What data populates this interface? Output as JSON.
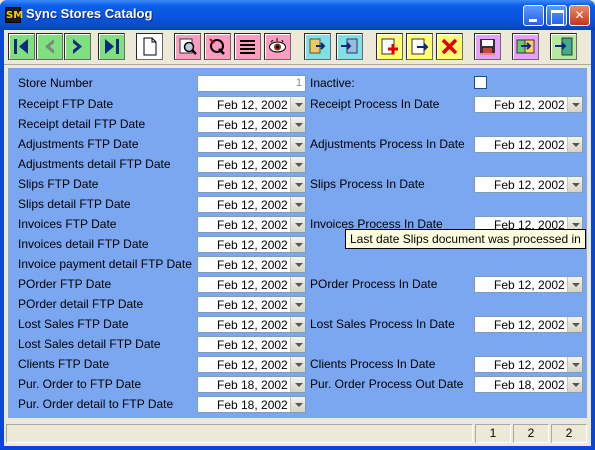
{
  "window": {
    "title": "Sync Stores Catalog",
    "icon_text": "SM"
  },
  "titlebar_buttons": [
    {
      "name": "minimize-button",
      "icon": "minimize-icon"
    },
    {
      "name": "maximize-button",
      "icon": "maximize-icon"
    },
    {
      "name": "close-button",
      "icon": "close-icon"
    }
  ],
  "toolbar": {
    "buttons": [
      {
        "name": "first-record-button",
        "icon": "first-record-icon",
        "bg": "#80e080"
      },
      {
        "name": "previous-record-button",
        "icon": "previous-record-icon",
        "bg": "#80e080"
      },
      {
        "name": "next-record-button",
        "icon": "next-record-icon",
        "bg": "#80e080"
      },
      {
        "name": "last-record-button",
        "icon": "last-record-icon",
        "bg": "#80e080"
      },
      {
        "name": "new-record-button",
        "icon": "new-document-icon",
        "bg": "#ffffff"
      },
      {
        "name": "find-button",
        "icon": "magnifier-icon",
        "bg": "#ff9cc0"
      },
      {
        "name": "query-button",
        "icon": "query-icon",
        "bg": "#ff9cc0"
      },
      {
        "name": "list-view-button",
        "icon": "list-icon",
        "bg": "#ff9cc0"
      },
      {
        "name": "preview-button",
        "icon": "eye-icon",
        "bg": "#ff9cc0"
      },
      {
        "name": "export-button",
        "icon": "export-icon",
        "bg": "#80e0e8"
      },
      {
        "name": "import-button",
        "icon": "import-icon",
        "bg": "#80e0e8"
      },
      {
        "name": "add-button",
        "icon": "add-icon",
        "bg": "#ffff70"
      },
      {
        "name": "edit-button",
        "icon": "edit-icon",
        "bg": "#ffff70"
      },
      {
        "name": "delete-button",
        "icon": "delete-icon",
        "bg": "#ffff70"
      },
      {
        "name": "save-button",
        "icon": "floppy-disk-icon",
        "bg": "#e8a0ff"
      },
      {
        "name": "sync-button",
        "icon": "sync-icon",
        "bg": "#e8a0ff"
      },
      {
        "name": "exit-button",
        "icon": "exit-icon",
        "bg": "#b8e8a0"
      }
    ]
  },
  "form": {
    "store_number": {
      "label": "Store Number",
      "value": "1"
    },
    "inactive": {
      "label": "Inactive:",
      "checked": false
    },
    "left_fields": [
      {
        "label": "Receipt FTP Date",
        "value": "Feb 12, 2002"
      },
      {
        "label": "Receipt detail FTP Date",
        "value": "Feb 12, 2002"
      },
      {
        "label": "Adjustments FTP Date",
        "value": "Feb 12, 2002"
      },
      {
        "label": "Adjustments detail FTP Date",
        "value": "Feb 12, 2002"
      },
      {
        "label": "Slips FTP Date",
        "value": "Feb 12, 2002"
      },
      {
        "label": "Slips detail FTP Date",
        "value": "Feb 12, 2002"
      },
      {
        "label": "Invoices FTP Date",
        "value": "Feb 12, 2002"
      },
      {
        "label": "Invoices detail FTP Date",
        "value": "Feb 12, 2002"
      },
      {
        "label": "Invoice payment detail FTP Date",
        "value": "Feb 12, 2002"
      },
      {
        "label": "POrder FTP Date",
        "value": "Feb 12, 2002"
      },
      {
        "label": "POrder detail FTP Date",
        "value": "Feb 12, 2002"
      },
      {
        "label": "Lost Sales FTP Date",
        "value": "Feb 12, 2002"
      },
      {
        "label": "Lost Sales detail FTP Date",
        "value": "Feb 12, 2002"
      },
      {
        "label": "Clients FTP Date",
        "value": "Feb 12, 2002"
      },
      {
        "label": "Pur. Order to FTP Date",
        "value": "Feb 18, 2002"
      },
      {
        "label": "Pur. Order detail to FTP Date",
        "value": "Feb 18, 2002"
      }
    ],
    "right_fields": [
      {
        "label": "Receipt Process In Date",
        "value": "Feb 12, 2002",
        "row": 0
      },
      {
        "label": "Adjustments Process In Date",
        "value": "Feb 12, 2002",
        "row": 2
      },
      {
        "label": "Slips Process In Date",
        "value": "Feb 12, 2002",
        "row": 4
      },
      {
        "label": "Invoices Process In Date",
        "value": "Feb 12, 2002",
        "row": 6
      },
      {
        "label": "POrder Process In Date",
        "value": "Feb 12, 2002",
        "row": 9
      },
      {
        "label": "Lost Sales Process In Date",
        "value": "Feb 12, 2002",
        "row": 11
      },
      {
        "label": "Clients Process In Date",
        "value": "Feb 12, 2002",
        "row": 13
      },
      {
        "label": "Pur. Order Process Out Date",
        "value": "Feb 18, 2002",
        "row": 14
      }
    ],
    "tooltip": "Last date Slips document was processed in"
  },
  "statusbar": {
    "message": "",
    "cells": [
      "1",
      "2",
      "2"
    ]
  }
}
